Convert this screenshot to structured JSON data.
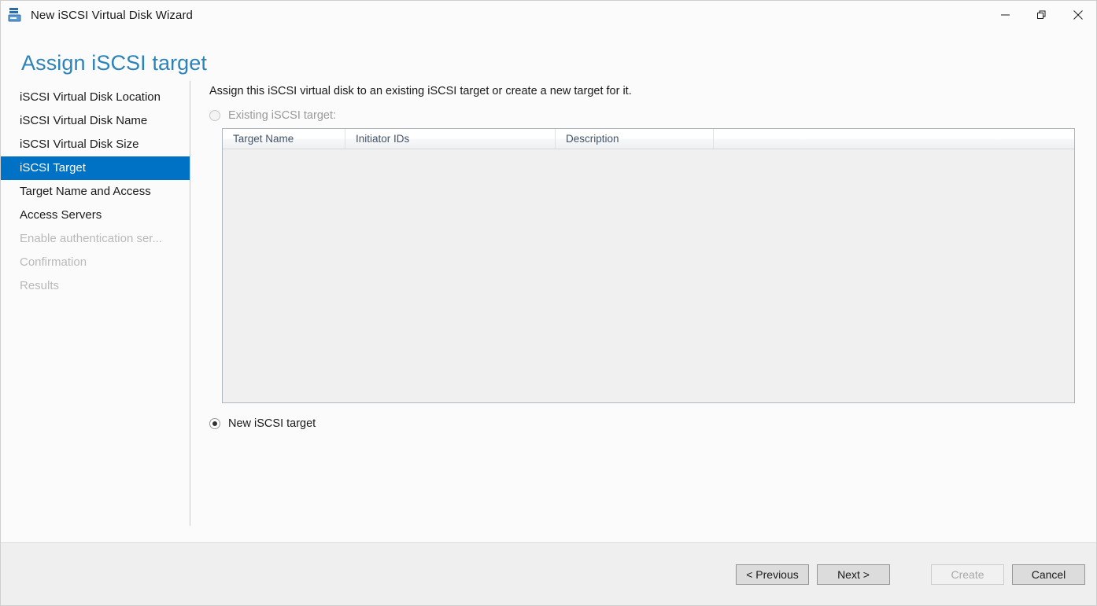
{
  "window": {
    "title": "New iSCSI Virtual Disk Wizard",
    "icon": "iscsi-virtual-disk-icon",
    "controls": {
      "minimize": "minimize-icon",
      "restore": "restore-icon",
      "close": "close-icon"
    }
  },
  "header": {
    "title": "Assign iSCSI target",
    "title_color": "#2c83b9"
  },
  "sidebar": {
    "accent_color": "#0072c6",
    "items": [
      {
        "label": "iSCSI Virtual Disk Location",
        "state": "enabled"
      },
      {
        "label": "iSCSI Virtual Disk Name",
        "state": "enabled"
      },
      {
        "label": "iSCSI Virtual Disk Size",
        "state": "enabled"
      },
      {
        "label": "iSCSI Target",
        "state": "selected"
      },
      {
        "label": "Target Name and Access",
        "state": "enabled"
      },
      {
        "label": "Access Servers",
        "state": "enabled"
      },
      {
        "label": "Enable authentication ser...",
        "state": "disabled"
      },
      {
        "label": "Confirmation",
        "state": "disabled"
      },
      {
        "label": "Results",
        "state": "disabled"
      }
    ]
  },
  "main": {
    "instruction": "Assign this iSCSI virtual disk to an existing iSCSI target or create a new target for it.",
    "existing_target": {
      "label": "Existing iSCSI target:",
      "checked": false,
      "disabled": true
    },
    "new_target": {
      "label": "New iSCSI target",
      "checked": true,
      "disabled": false
    },
    "table": {
      "columns": [
        "Target Name",
        "Initiator IDs",
        "Description",
        ""
      ],
      "rows": []
    }
  },
  "footer": {
    "buttons": [
      {
        "label": "< Previous",
        "state": "enabled"
      },
      {
        "label": "Next >",
        "state": "enabled"
      },
      {
        "label": "Create",
        "state": "disabled"
      },
      {
        "label": "Cancel",
        "state": "enabled"
      }
    ]
  }
}
